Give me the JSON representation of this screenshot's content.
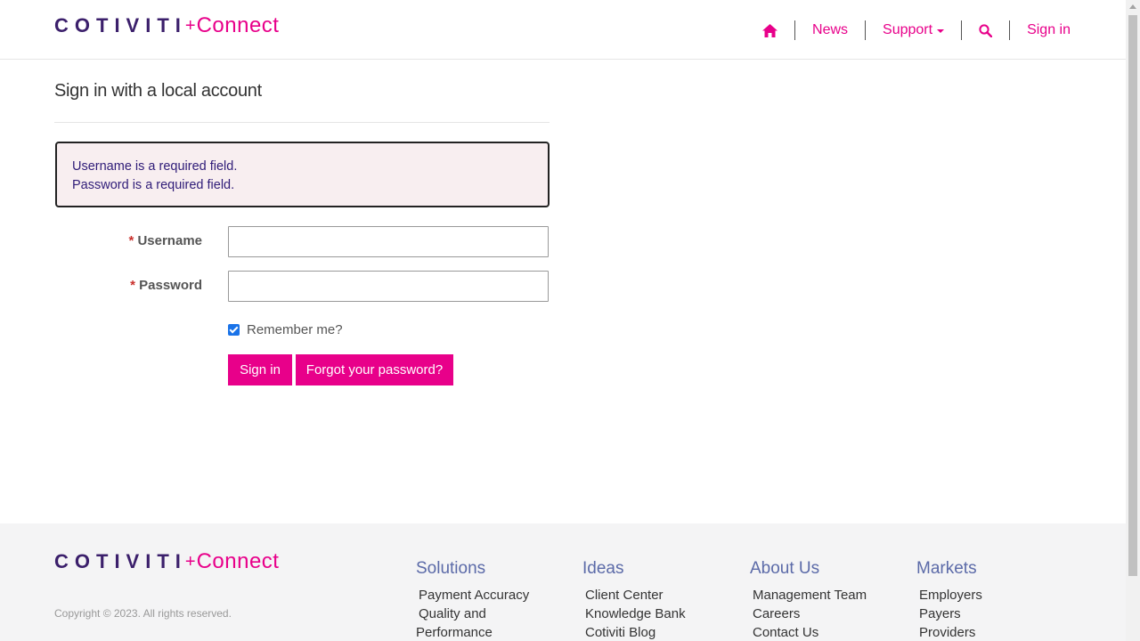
{
  "header": {
    "logo_main": "COTIVITI",
    "logo_plus": "+",
    "logo_sub": "Connect",
    "nav": {
      "home_icon": "home-icon",
      "news": "News",
      "support": "Support",
      "search_icon": "search-icon",
      "sign_in": "Sign in"
    }
  },
  "main": {
    "title": "Sign in with a local account",
    "errors": [
      "Username is a required field.",
      "Password is a required field."
    ],
    "username_label": "Username",
    "password_label": "Password",
    "required_marker": "*",
    "username_value": "",
    "password_value": "",
    "remember_label": "Remember me?",
    "remember_checked": true,
    "sign_in_button": "Sign in",
    "forgot_button": "Forgot your password?"
  },
  "footer": {
    "logo_main": "COTIVITI",
    "logo_plus": "+",
    "logo_sub": "Connect",
    "copyright": "Copyright © 2023. All rights reserved.",
    "columns": [
      {
        "title": "Solutions",
        "links": [
          "Payment Accuracy",
          "Quality and",
          "Performance"
        ]
      },
      {
        "title": "Ideas",
        "links": [
          "Client Center",
          "Knowledge Bank",
          "Cotiviti Blog"
        ]
      },
      {
        "title": "About Us",
        "links": [
          "Management Team",
          "Careers",
          "Contact Us"
        ]
      },
      {
        "title": "Markets",
        "links": [
          "Employers",
          "Payers",
          "Providers"
        ]
      }
    ]
  },
  "colors": {
    "brand_primary": "#e8008a",
    "brand_dark": "#3b1f6b",
    "error_text": "#2f1c78",
    "error_bg": "#f8eef0"
  }
}
